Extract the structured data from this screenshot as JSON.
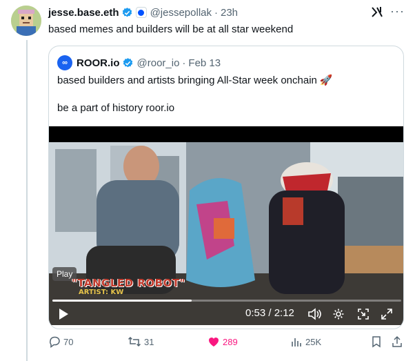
{
  "tweet": {
    "author_name": "jesse.base.eth",
    "handle": "@jessepollak",
    "separator": "·",
    "time": "23h",
    "text": "based memes and builders will be at all star weekend"
  },
  "quoted_tweet": {
    "author_name": "ROOR.io",
    "avatar_text": "∞",
    "handle": "@roor_io",
    "separator": "·",
    "date": "Feb 13",
    "text_line1": "based builders and artists bringing All-Star week onchain",
    "rocket": "🚀",
    "text_line2": "be a part of history roor.io"
  },
  "video": {
    "tooltip": "Play",
    "caption_title": "\"TANGLED ROBOT\"",
    "caption_artist": "ARTIST: KW",
    "time_display": "0:53 / 2:12",
    "progress_fraction": 0.4
  },
  "actions": {
    "replies": "70",
    "reposts": "31",
    "likes": "289",
    "views": "25K"
  },
  "colors": {
    "verified": "#1d9bf0",
    "like": "#f91880",
    "muted": "#536471",
    "border": "#cfd9de"
  }
}
